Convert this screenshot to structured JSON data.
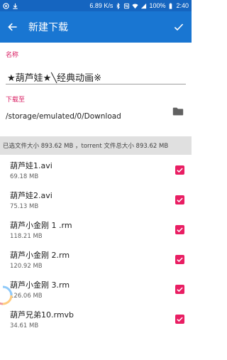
{
  "status_bar": {
    "speed": "6.89 K/s",
    "battery": "100%",
    "time": "2:40"
  },
  "app_bar": {
    "title": "新建下载"
  },
  "name_section": {
    "label": "名称",
    "value": "★葫芦娃★╲经典动画※"
  },
  "save_section": {
    "label": "下载至",
    "path": "/storage/emulated/0/Download"
  },
  "summary": "已选文件大小 893.62 MB ，torrent 文件总大小 893.62 MB",
  "files": [
    {
      "name": "葫芦娃1.avi",
      "size": "69.18 MB",
      "checked": true
    },
    {
      "name": "葫芦娃2.avi",
      "size": "75.13 MB",
      "checked": true
    },
    {
      "name": "葫芦小金刚 1 .rm",
      "size": "118.21 MB",
      "checked": true
    },
    {
      "name": "葫芦小金刚 2.rm",
      "size": "120.92 MB",
      "checked": true
    },
    {
      "name": "葫芦小金刚 3.rm",
      "size": "126.06 MB",
      "checked": true
    },
    {
      "name": "葫芦兄弟10.rmvb",
      "size": "34.61 MB",
      "checked": true
    }
  ],
  "colors": {
    "status_bar": "#1565c0",
    "app_bar": "#1976d2",
    "accent": "#d81b60",
    "checkbox": "#e91e63"
  },
  "icons": {
    "back": "arrow-left-icon",
    "confirm": "check-icon",
    "folder": "folder-icon"
  }
}
